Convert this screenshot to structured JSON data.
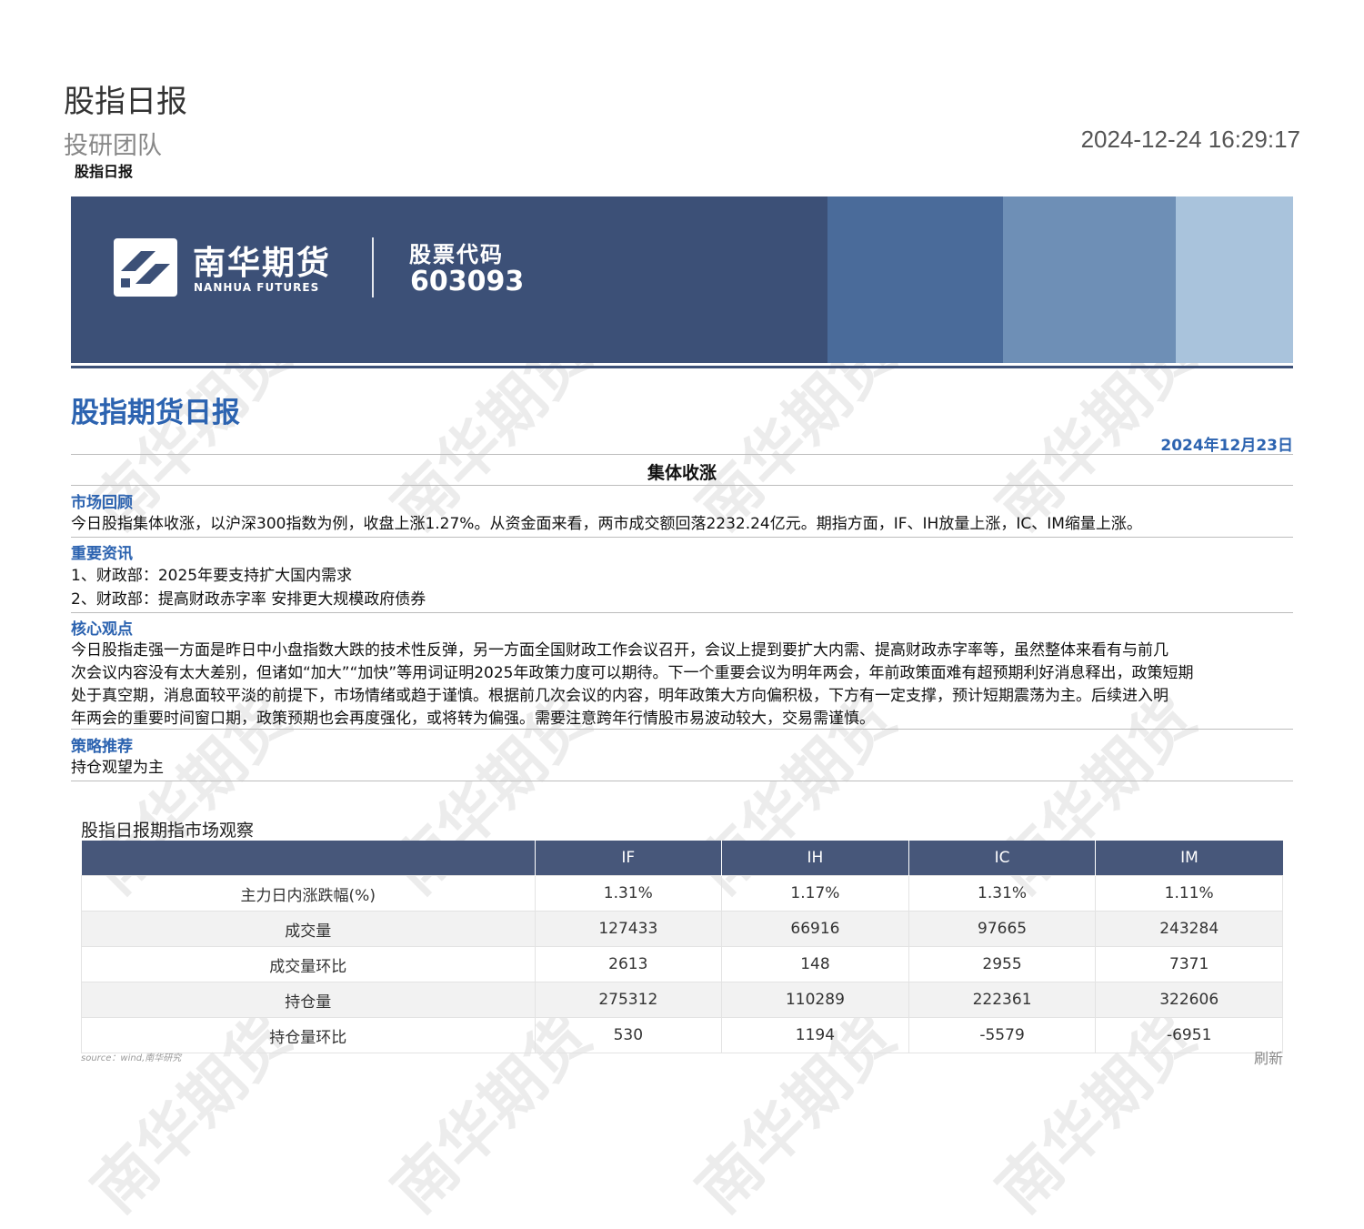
{
  "header": {
    "doc_title": "股指日报",
    "team": "投研团队",
    "timestamp": "2024-12-24 16:29:17",
    "crumb": "股指日报"
  },
  "banner": {
    "brand_cn": "南华期货",
    "brand_en": "NANHUA FUTURES",
    "code_label": "股票代码",
    "code_value": "603093",
    "colors": {
      "base": "#3c5077",
      "band1": "#4a6b9a",
      "band2": "#6e8fb6",
      "band3": "#a9c3dc"
    },
    "logo_icon": "nanhua-logo-icon"
  },
  "report": {
    "title": "股指期货日报",
    "date": "2024年12月23日",
    "summary_title": "集体收涨",
    "accent_color": "#2c63b0"
  },
  "sections": {
    "market_review": {
      "heading": "市场回顾",
      "text": "今日股指集体收涨，以沪深300指数为例，收盘上涨1.27%。从资金面来看，两市成交额回落2232.24亿元。期指方面，IF、IH放量上涨，IC、IM缩量上涨。"
    },
    "key_news": {
      "heading": "重要资讯",
      "items": [
        "1、财政部：2025年要支持扩大国内需求",
        "2、财政部：提高财政赤字率 安排更大规模政府债券"
      ]
    },
    "core_view": {
      "heading": "核心观点",
      "lines": [
        "今日股指走强一方面是昨日中小盘指数大跌的技术性反弹，另一方面全国财政工作会议召开，会议上提到要扩大内需、提高财政赤字率等，虽然整体来看有与前几",
        "次会议内容没有太大差别，但诸如“加大”“加快”等用词证明2025年政策力度可以期待。下一个重要会议为明年两会，年前政策面难有超预期利好消息释出，政策短期",
        "处于真空期，消息面较平淡的前提下，市场情绪或趋于谨慎。根据前几次会议的内容，明年政策大方向偏积极，下方有一定支撑，预计短期震荡为主。后续进入明",
        "年两会的重要时间窗口期，政策预期也会再度强化，或将转为偏强。需要注意跨年行情股市易波动较大，交易需谨慎。"
      ]
    },
    "strategy": {
      "heading": "策略推荐",
      "text": "持仓观望为主"
    }
  },
  "table": {
    "title": "股指日报期指市场观察",
    "columns": [
      "IF",
      "IH",
      "IC",
      "IM"
    ],
    "rows": [
      {
        "label": "主力日内涨跌幅(%)",
        "values": [
          "1.31%",
          "1.17%",
          "1.31%",
          "1.11%"
        ]
      },
      {
        "label": "成交量",
        "values": [
          "127433",
          "66916",
          "97665",
          "243284"
        ]
      },
      {
        "label": "成交量环比",
        "values": [
          "2613",
          "148",
          "2955",
          "7371"
        ]
      },
      {
        "label": "持仓量",
        "values": [
          "275312",
          "110289",
          "222361",
          "322606"
        ]
      },
      {
        "label": "持仓量环比",
        "values": [
          "530",
          "1194",
          "-5579",
          "-6951"
        ]
      }
    ],
    "header_color": "#47577a",
    "source": "source：wind,南华研究",
    "refresh": "刷新"
  },
  "watermark": "南华期货"
}
